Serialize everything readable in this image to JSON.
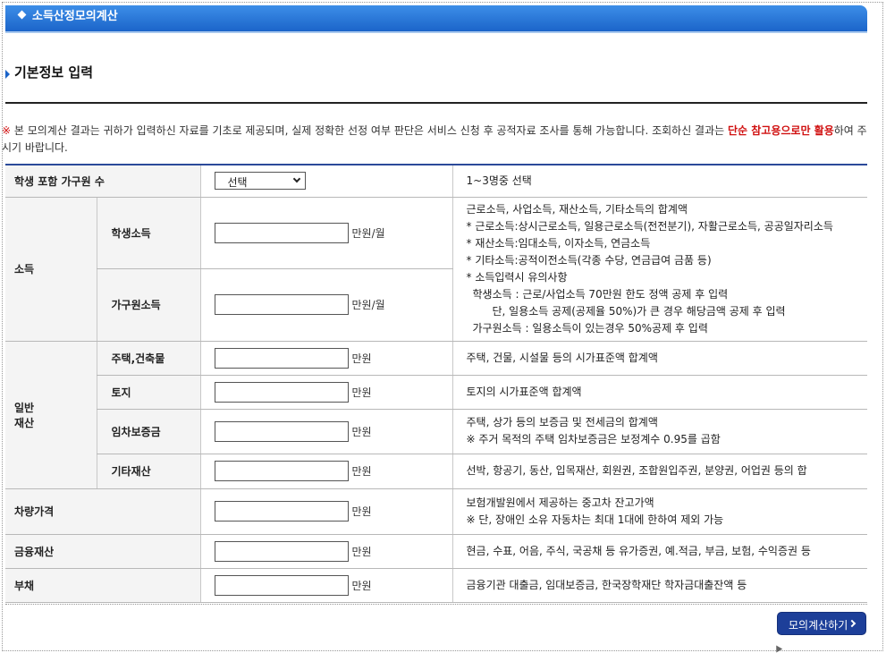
{
  "header": {
    "title": "소득산정모의계산"
  },
  "section": {
    "title": "기본정보 입력"
  },
  "notice": {
    "mark": "※",
    "text": " 본 모의계산 결과는 귀하가 입력하신 자료를 기초로 제공되며, 실제 정확한 선정 여부 판단은 서비스 신청 후 공적자료 조사를 통해 가능합니다. 조회하신 결과는 ",
    "highlight": "단순 참고용으로만 활용",
    "tail": "하여 주시기 바랍니다."
  },
  "household": {
    "label": "학생 포함 가구원 수",
    "select_value": "선택",
    "desc": "1~3명중 선택"
  },
  "income": {
    "label": "소득",
    "student": {
      "label": "학생소득",
      "value": "",
      "unit": "만원/월"
    },
    "family": {
      "label": "가구원소득",
      "value": "",
      "unit": "만원/월"
    },
    "desc": [
      "근로소득, 사업소득, 재산소득, 기타소득의 합계액",
      "* 근로소득:상시근로소득, 일용근로소득(전전분기), 자활근로소득, 공공일자리소득",
      "* 재산소득:임대소득, 이자소득, 연금소득",
      "* 기타소득:공적이전소득(각종 수당, 연금급여 금품 등)",
      "* 소득입력시 유의사항",
      "학생소득 : 근로/사업소득 70만원 한도 정액 공제 후 입력",
      "단, 일용소득 공제(공제율 50%)가 큰 경우 해당금액 공제 후 입력",
      "가구원소득 : 일용소득이 있는경우 50%공제 후 입력"
    ]
  },
  "property": {
    "label_line1": "일반",
    "label_line2": "재산",
    "housing": {
      "label": "주택,건축물",
      "value": "",
      "unit": "만원",
      "desc": "주택, 건물, 시설물 등의 시가표준액 합계액"
    },
    "land": {
      "label": "토지",
      "value": "",
      "unit": "만원",
      "desc": "토지의 시가표준액 합계액"
    },
    "deposit": {
      "label": "임차보증금",
      "value": "",
      "unit": "만원",
      "desc1": "주택, 상가 등의 보증금 및 전세금의 합계액",
      "desc2": "※ 주거 목적의 주택 임차보증금은 보정계수 0.95를 곱함"
    },
    "other": {
      "label": "기타재산",
      "value": "",
      "unit": "만원",
      "desc": "선박, 항공기, 동산, 입목재산, 회원권, 조합원입주권, 분양권, 어업권 등의 합"
    }
  },
  "vehicle": {
    "label": "차량가격",
    "value": "",
    "unit": "만원",
    "desc1": "보험개발원에서 제공하는 중고차 잔고가액",
    "desc2": "※ 단, 장애인 소유 자동차는 최대 1대에 한하여 제외 가능"
  },
  "financial": {
    "label": "금융재산",
    "value": "",
    "unit": "만원",
    "desc": "현금, 수표, 어음, 주식, 국공채 등 유가증권, 예.적금, 부금, 보험, 수익증권 등"
  },
  "debt": {
    "label": "부채",
    "value": "",
    "unit": "만원",
    "desc": "금융기관 대출금, 임대보증금, 한국장학재단 학자금대출잔액 등"
  },
  "actions": {
    "calc_label": "모의계산하기"
  }
}
